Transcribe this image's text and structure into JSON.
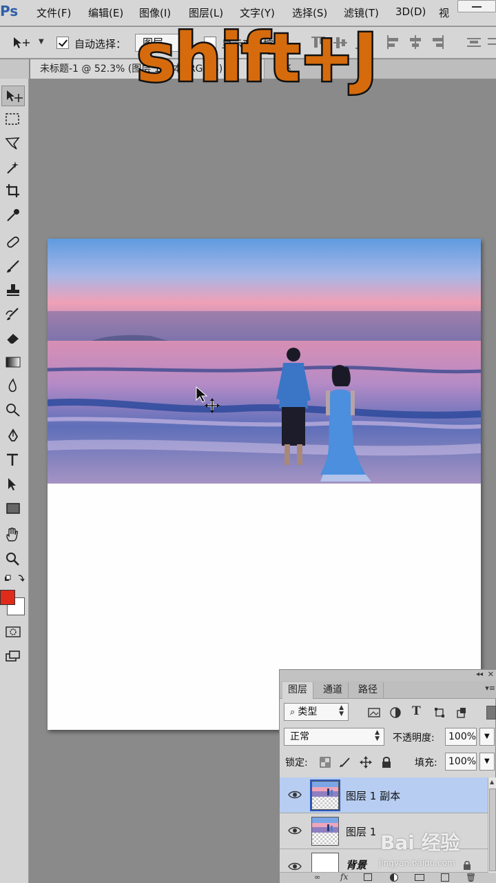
{
  "app": {
    "logo": "Ps"
  },
  "menu": {
    "items": [
      "文件(F)",
      "编辑(E)",
      "图像(I)",
      "图层(L)",
      "文字(Y)",
      "选择(S)",
      "滤镜(T)",
      "3D(D)",
      "视"
    ]
  },
  "options": {
    "auto_select_label": "自动选择：",
    "auto_select_value": "图层",
    "transform_label": "显示变换控件"
  },
  "document": {
    "tab_title": "未标题-1 @ 52.3% (图层 1 副本, RGB/8)"
  },
  "overlay": {
    "shortcut": "shift+J"
  },
  "colors": {
    "foreground": "#e02a1a",
    "background": "#ffffff",
    "selected_layer": "#b7cdf1",
    "overlay_text": "#d56b0c"
  },
  "tools": [
    "move-icon",
    "marquee-icon",
    "lasso-icon",
    "magic-wand-icon",
    "crop-icon",
    "eyedropper-icon",
    "healing-icon",
    "brush-icon",
    "stamp-icon",
    "history-brush-icon",
    "eraser-icon",
    "gradient-icon",
    "blur-icon",
    "dodge-icon",
    "pen-icon",
    "type-icon",
    "path-select-icon",
    "rectangle-icon",
    "hand-icon",
    "zoom-icon"
  ],
  "layers_panel": {
    "tabs": [
      "图层",
      "通道",
      "路径"
    ],
    "filter_label": "类型",
    "blend_mode": "正常",
    "opacity_label": "不透明度:",
    "opacity_value": "100%",
    "lock_label": "锁定:",
    "fill_label": "填充:",
    "fill_value": "100%",
    "layers": [
      {
        "name": "图层 1 副本",
        "selected": true
      },
      {
        "name": "图层 1",
        "selected": false
      },
      {
        "name": "背景",
        "selected": false
      }
    ]
  },
  "watermark": {
    "text": "Bai 经验",
    "sub": "jingyan.baidu.com"
  }
}
